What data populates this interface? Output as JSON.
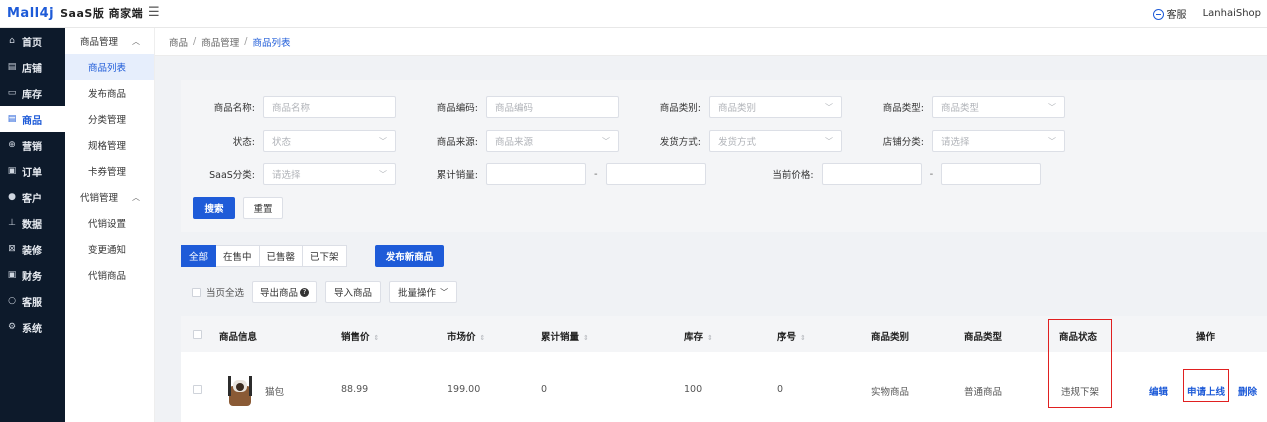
{
  "header": {
    "logo": "Mall4j",
    "edition": "SaaS版 商家端",
    "collapse_icon": "menu-fold-icon",
    "service": "客服",
    "user": "LanhaiShop"
  },
  "sidebar": {
    "items": [
      {
        "icon": "⌂",
        "label": "首页"
      },
      {
        "icon": "▤",
        "label": "店铺"
      },
      {
        "icon": "▭",
        "label": "库存"
      },
      {
        "icon": "▤",
        "label": "商品"
      },
      {
        "icon": "⊕",
        "label": "营销"
      },
      {
        "icon": "▣",
        "label": "订单"
      },
      {
        "icon": "●",
        "label": "客户"
      },
      {
        "icon": "⊥",
        "label": "数据"
      },
      {
        "icon": "⊠",
        "label": "装修"
      },
      {
        "icon": "▣",
        "label": "财务"
      },
      {
        "icon": "○",
        "label": "客服"
      },
      {
        "icon": "⚙",
        "label": "系统"
      }
    ]
  },
  "subnav": {
    "group1": "商品管理",
    "items1": [
      "商品列表",
      "发布商品",
      "分类管理",
      "规格管理",
      "卡券管理"
    ],
    "group2": "代销管理",
    "items2": [
      "代销设置",
      "变更通知",
      "代销商品"
    ]
  },
  "breadcrumb": [
    "商品",
    "商品管理",
    "商品列表"
  ],
  "filters": {
    "name": {
      "label": "商品名称:",
      "placeholder": "商品名称"
    },
    "code": {
      "label": "商品编码:",
      "placeholder": "商品编码"
    },
    "category": {
      "label": "商品类别:",
      "placeholder": "商品类别"
    },
    "type": {
      "label": "商品类型:",
      "placeholder": "商品类型"
    },
    "status": {
      "label": "状态:",
      "placeholder": "状态"
    },
    "source": {
      "label": "商品来源:",
      "placeholder": "商品来源"
    },
    "delivery": {
      "label": "发货方式:",
      "placeholder": "发货方式"
    },
    "shop_cat": {
      "label": "店铺分类:",
      "placeholder": "请选择"
    },
    "saas_cat": {
      "label": "SaaS分类:",
      "placeholder": "请选择"
    },
    "sales": {
      "label": "累计销量:",
      "dash": "-"
    },
    "price": {
      "label": "当前价格:",
      "dash": "-"
    },
    "search": "搜索",
    "reset": "重置"
  },
  "tabs": [
    "全部",
    "在售中",
    "已售罄",
    "已下架"
  ],
  "publish": "发布新商品",
  "bulk": {
    "select_all": "当页全选",
    "export": "导出商品",
    "import": "导入商品",
    "batch": "批量操作"
  },
  "table": {
    "headers": {
      "info": "商品信息",
      "price": "销售价",
      "market": "市场价",
      "sales": "累计销量",
      "stock": "库存",
      "seq": "序号",
      "category": "商品类别",
      "type": "商品类型",
      "status": "商品状态",
      "ops": "操作"
    },
    "row": {
      "name": "猫包",
      "price": "88.99",
      "market": "199.00",
      "sales": "0",
      "stock": "100",
      "seq": "0",
      "category": "实物商品",
      "type": "普通商品",
      "status": "违规下架",
      "edit": "编辑",
      "apply": "申请上线",
      "delete": "删除"
    }
  },
  "colors": {
    "primary": "#1e5bd8",
    "sidebar": "#0d1a2b",
    "highlight": "#e02020"
  }
}
